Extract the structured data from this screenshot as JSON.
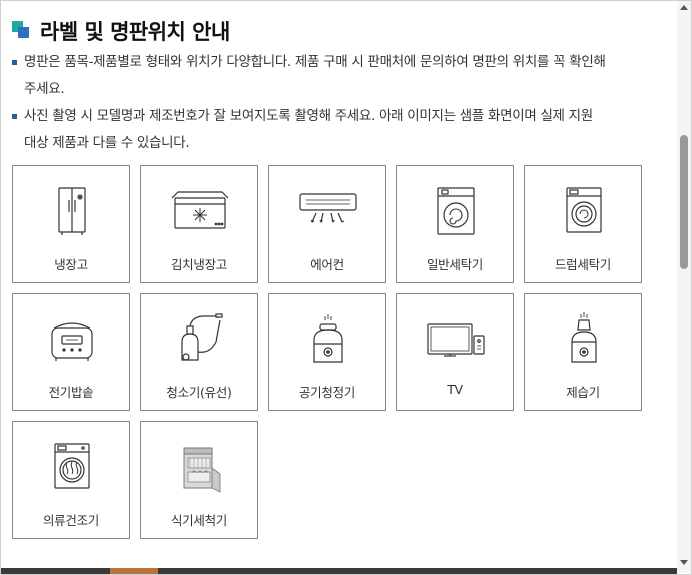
{
  "title": "라벨 및 명판위치 안내",
  "notes": [
    "명판은 품목-제품별로 형태와 위치가 다양합니다. 제품 구매 시 판매처에 문의하여 명판의 위치를 꼭 확인해 주세요.",
    "사진 촬영 시 모델명과 제조번호가 잘 보여지도록 촬영해 주세요. 아래 이미지는 샘플 화면이며 실제 지원 대상 제품과 다를 수 있습니다."
  ],
  "notes_lines": [
    [
      "명판은 품목-제품별로 형태와 위치가 다양합니다. 제품 구매 시 판매처에 문의하여 명판의 위치를 꼭 확인해",
      "주세요."
    ],
    [
      "사진 촬영 시 모델명과 제조번호가 잘 보여지도록 촬영해 주세요. 아래 이미지는 샘플 화면이며 실제 지원",
      "대상 제품과 다를 수 있습니다."
    ]
  ],
  "products": [
    {
      "label": "냉장고",
      "icon": "refrigerator-icon"
    },
    {
      "label": "김치냉장고",
      "icon": "kimchi-refrigerator-icon"
    },
    {
      "label": "에어컨",
      "icon": "air-conditioner-icon"
    },
    {
      "label": "일반세탁기",
      "icon": "top-load-washer-icon"
    },
    {
      "label": "드럼세탁기",
      "icon": "drum-washer-icon"
    },
    {
      "label": "전기밥솥",
      "icon": "rice-cooker-icon"
    },
    {
      "label": "청소기(유선)",
      "icon": "vacuum-cleaner-icon"
    },
    {
      "label": "공기청정기",
      "icon": "air-purifier-icon"
    },
    {
      "label": "TV",
      "icon": "tv-icon"
    },
    {
      "label": "제습기",
      "icon": "dehumidifier-icon"
    },
    {
      "label": "의류건조기",
      "icon": "clothes-dryer-icon"
    },
    {
      "label": "식기세척기",
      "icon": "dishwasher-icon"
    }
  ],
  "colors": {
    "title_mark_teal": "#1fa8a0",
    "title_mark_blue": "#2f6fc4",
    "bullet": "#2a5da8",
    "card_border": "#888888"
  }
}
